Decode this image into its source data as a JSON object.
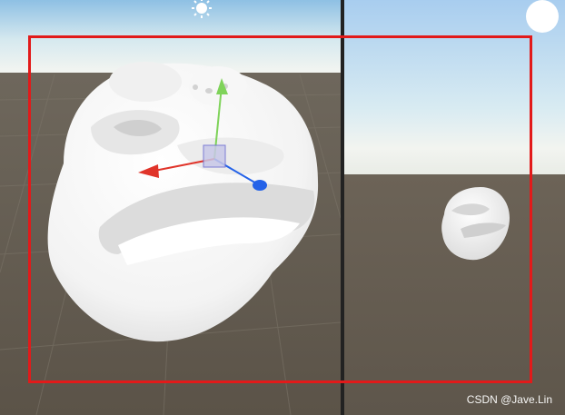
{
  "watermark": "CSDN @Jave.Lin",
  "colors": {
    "highlight": "#e21a1a",
    "ground": "#5f574c",
    "sky_top": "#9fc6e8",
    "horizon": "#f2f4f2",
    "gizmo_x": "#e0342a",
    "gizmo_y": "#7fd35a",
    "gizmo_z": "#2462e8"
  },
  "icons": {
    "sun": "directional-light-icon",
    "model": "toad-statue-model"
  }
}
